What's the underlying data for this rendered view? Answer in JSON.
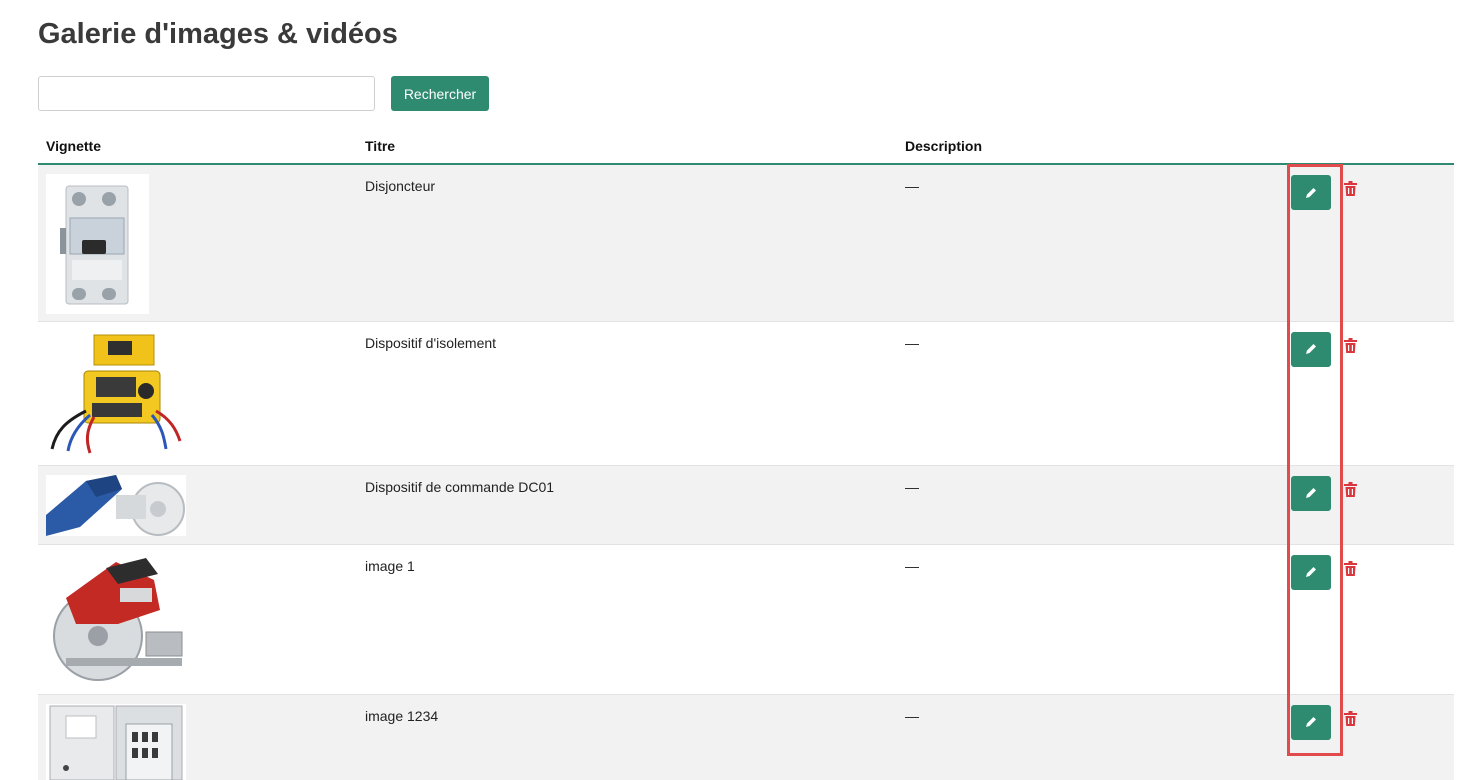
{
  "page": {
    "title": "Galerie d'images & vidéos"
  },
  "search": {
    "placeholder": "",
    "value": "",
    "button_label": "Rechercher"
  },
  "table": {
    "headers": {
      "thumbnail": "Vignette",
      "title": "Titre",
      "description": "Description"
    },
    "rows": [
      {
        "title": "Disjoncteur",
        "description": "—",
        "thumbnail_icon": "circuit-breaker-image"
      },
      {
        "title": "Dispositif d'isolement",
        "description": "—",
        "thumbnail_icon": "insulation-tester-image"
      },
      {
        "title": "Dispositif de commande DC01",
        "description": "—",
        "thumbnail_icon": "blue-power-tool-image"
      },
      {
        "title": "image 1",
        "description": "—",
        "thumbnail_icon": "circular-saw-image"
      },
      {
        "title": "image 1234",
        "description": "—",
        "thumbnail_icon": "electrical-panel-image"
      }
    ]
  },
  "icons": {
    "edit": "pencil-icon",
    "delete": "trash-icon"
  },
  "colors": {
    "accent": "#2e8b70",
    "delete": "#d9363e",
    "highlight": "#e24b4b",
    "row_alt": "#f2f2f2"
  }
}
